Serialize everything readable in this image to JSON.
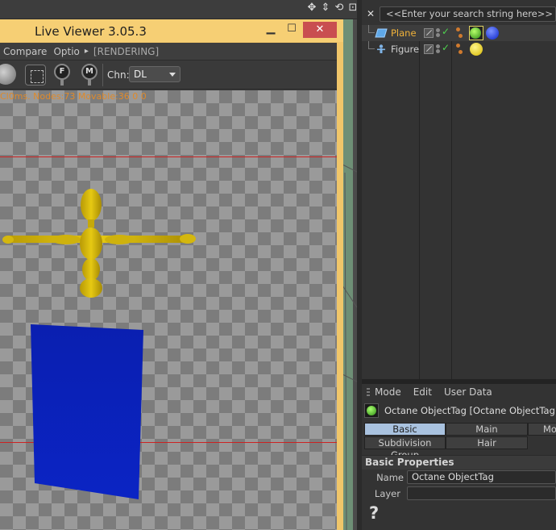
{
  "live_viewer": {
    "title": "Live Viewer 3.05.3",
    "menu": {
      "compare": "Compare",
      "options": "Optio",
      "arrow": "▸",
      "status": "[RENDERING]"
    },
    "toolbar": {
      "pin_f": "F",
      "pin_m": "M",
      "channel_label": "Chn:",
      "channel_value": "DL"
    },
    "stats": "Cl0ms. Nodes:73 Movable:36  0 0"
  },
  "object_manager": {
    "search_placeholder": "<<Enter your search string here>>",
    "objects": [
      {
        "name": "Plane",
        "name_color": "#f0b23a"
      },
      {
        "name": "Figure",
        "name_color": "#cfcfcf"
      }
    ]
  },
  "attribute_manager": {
    "menu": [
      "Mode",
      "Edit",
      "User Data"
    ],
    "header": "Octane ObjectTag [Octane ObjectTag]",
    "tabs_row1": [
      "Basic",
      "Main",
      "Mo"
    ],
    "tabs_row2": [
      "Subdivision Group",
      "Hair"
    ],
    "section_title": "Basic Properties",
    "name_label": "Name",
    "name_value": "Octane ObjectTag",
    "layer_label": "Layer",
    "layer_value": "",
    "help": "?"
  },
  "colors": {
    "plane_blue": "#0a21b4",
    "figure_yellow": "#d9be0c",
    "close_red": "#c94e50",
    "tab_active": "#a9c2df",
    "stats_orange": "#e08a2a"
  }
}
